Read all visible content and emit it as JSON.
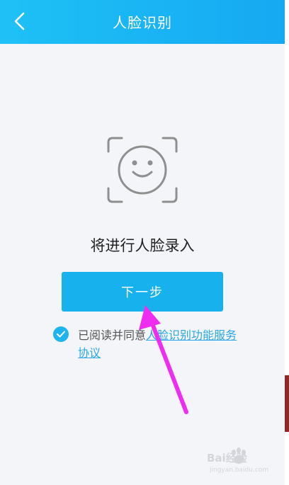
{
  "header": {
    "title": "人脸识别",
    "back_icon": "chevron-left-icon"
  },
  "face": {
    "icon": "face-scan-icon"
  },
  "main": {
    "prompt": "将进行人脸录入",
    "next_button": "下一步"
  },
  "agreement": {
    "checked": true,
    "prefix": "已阅读并同意",
    "link": "人脸识别功能服务协议"
  },
  "colors": {
    "header_gradient_start": "#1ec1f6",
    "header_gradient_end": "#16a9f2",
    "button": "#17b2ee",
    "link": "#2aa7e6",
    "annotation_arrow": "#ee2df0"
  },
  "watermark": {
    "text": "Bai经验",
    "domain": "jingyan.baidu.com"
  }
}
